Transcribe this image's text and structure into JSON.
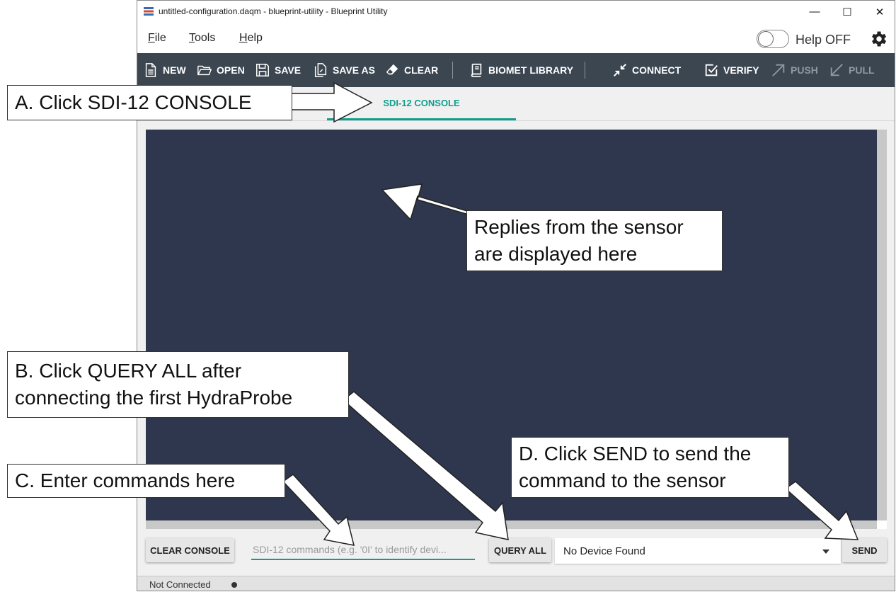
{
  "window": {
    "title": "untitled-configuration.daqm - blueprint-utility - Blueprint Utility",
    "controls": {
      "minimize": "—",
      "maximize": "☐",
      "close": "✕"
    }
  },
  "menu": {
    "file": "File",
    "tools": "Tools",
    "help": "Help"
  },
  "help_toggle": {
    "label": "Help OFF",
    "state": "off"
  },
  "toolbar": {
    "new": "NEW",
    "open": "OPEN",
    "save": "SAVE",
    "save_as": "SAVE AS",
    "clear": "CLEAR",
    "biomet_library": "BIOMET LIBRARY",
    "connect": "CONNECT",
    "verify": "VERIFY",
    "push": "PUSH",
    "pull": "PULL"
  },
  "tabs": [
    {
      "label": "SDI-12 CONSOLE",
      "active": true
    }
  ],
  "console": {
    "clear_button": "CLEAR CONSOLE",
    "command_placeholder": "SDI-12 commands (e.g. '0I' to identify devi...",
    "query_all_button": "QUERY ALL",
    "device_select": {
      "selected": "No Device Found"
    },
    "send_button": "SEND"
  },
  "status": {
    "connection": "Not Connected"
  },
  "annotations": {
    "a": {
      "lines": [
        "A. Click SDI-12 CONSOLE"
      ]
    },
    "replies": {
      "lines": [
        "Replies from the sensor",
        "are displayed here"
      ]
    },
    "b": {
      "lines": [
        "B. Click QUERY ALL after",
        "connecting the first HydraProbe"
      ]
    },
    "c": {
      "lines": [
        "C. Enter commands here"
      ]
    },
    "d": {
      "lines": [
        "D. Click SEND to send the",
        "command to the sensor"
      ]
    }
  },
  "colors": {
    "toolbar_bg": "#3b4651",
    "accent": "#0e9e8e",
    "console_bg": "#2e374e",
    "window_bg": "#f0f0f0"
  },
  "icons": {
    "app": "blueprint-app-icon",
    "new": "new-file-icon",
    "open": "folder-open-icon",
    "save": "floppy-disk-icon",
    "save_as": "save-as-icon",
    "clear": "eraser-icon",
    "biomet_library": "book-icon",
    "connect": "connect-arrows-icon",
    "verify": "checkbox-icon",
    "push": "arrow-up-right-icon",
    "pull": "arrow-down-left-icon",
    "settings": "gear-icon",
    "dropdown": "caret-down-icon"
  }
}
